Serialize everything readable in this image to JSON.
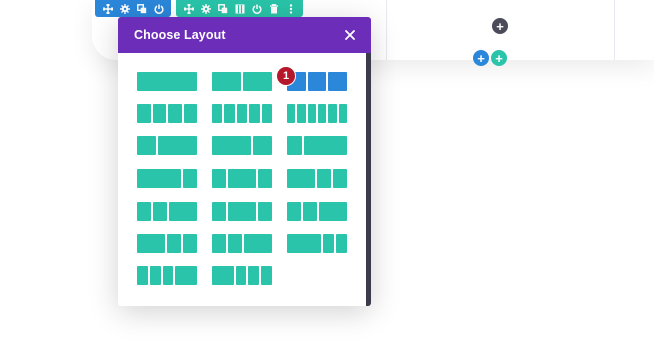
{
  "colors": {
    "section": "#2b87da",
    "row": "#29c4a9",
    "modal_header": "#6c2eb9",
    "layout_block": "#29c4a9",
    "layout_selected": "#2b87da",
    "badge": "#b5172b",
    "add_dark": "#4b4b5a"
  },
  "section_toolbar": {
    "icons": [
      "move-icon",
      "gear-icon",
      "duplicate-icon",
      "power-icon"
    ]
  },
  "row_toolbar": {
    "icons": [
      "move-icon",
      "gear-icon",
      "duplicate-icon",
      "columns-icon",
      "power-icon",
      "trash-icon",
      "more-icon"
    ]
  },
  "modal": {
    "title": "Choose Layout",
    "close_icon": "close-icon",
    "badge": "1",
    "layouts": [
      {
        "cols": [
          1
        ],
        "selected": false
      },
      {
        "cols": [
          1,
          1
        ],
        "selected": false
      },
      {
        "cols": [
          1,
          1,
          1
        ],
        "selected": true
      },
      {
        "cols": [
          1,
          1,
          1,
          1
        ],
        "selected": false
      },
      {
        "cols": [
          1,
          1,
          1,
          1,
          1
        ],
        "selected": false
      },
      {
        "cols": [
          1,
          1,
          1,
          1,
          1,
          1
        ],
        "selected": false
      },
      {
        "cols": [
          1,
          2
        ],
        "selected": false
      },
      {
        "cols": [
          2,
          1
        ],
        "selected": false
      },
      {
        "cols": [
          1,
          3
        ],
        "selected": false
      },
      {
        "cols": [
          3,
          1
        ],
        "selected": false
      },
      {
        "cols": [
          1,
          2,
          1
        ],
        "selected": false
      },
      {
        "cols": [
          2,
          1,
          1
        ],
        "selected": false
      },
      {
        "cols": [
          1,
          1,
          2
        ],
        "selected": false
      },
      {
        "cols": [
          1,
          2,
          1
        ],
        "selected": false
      },
      {
        "cols": [
          1,
          1,
          2
        ],
        "selected": false
      },
      {
        "cols": [
          2,
          1,
          1
        ],
        "selected": false
      },
      {
        "cols": [
          1,
          1,
          2
        ],
        "selected": false
      },
      {
        "cols": [
          3,
          1,
          1
        ],
        "selected": false
      },
      {
        "cols": [
          1,
          1,
          1,
          2
        ],
        "selected": false
      },
      {
        "cols": [
          2,
          1,
          1,
          1
        ],
        "selected": false
      }
    ]
  }
}
